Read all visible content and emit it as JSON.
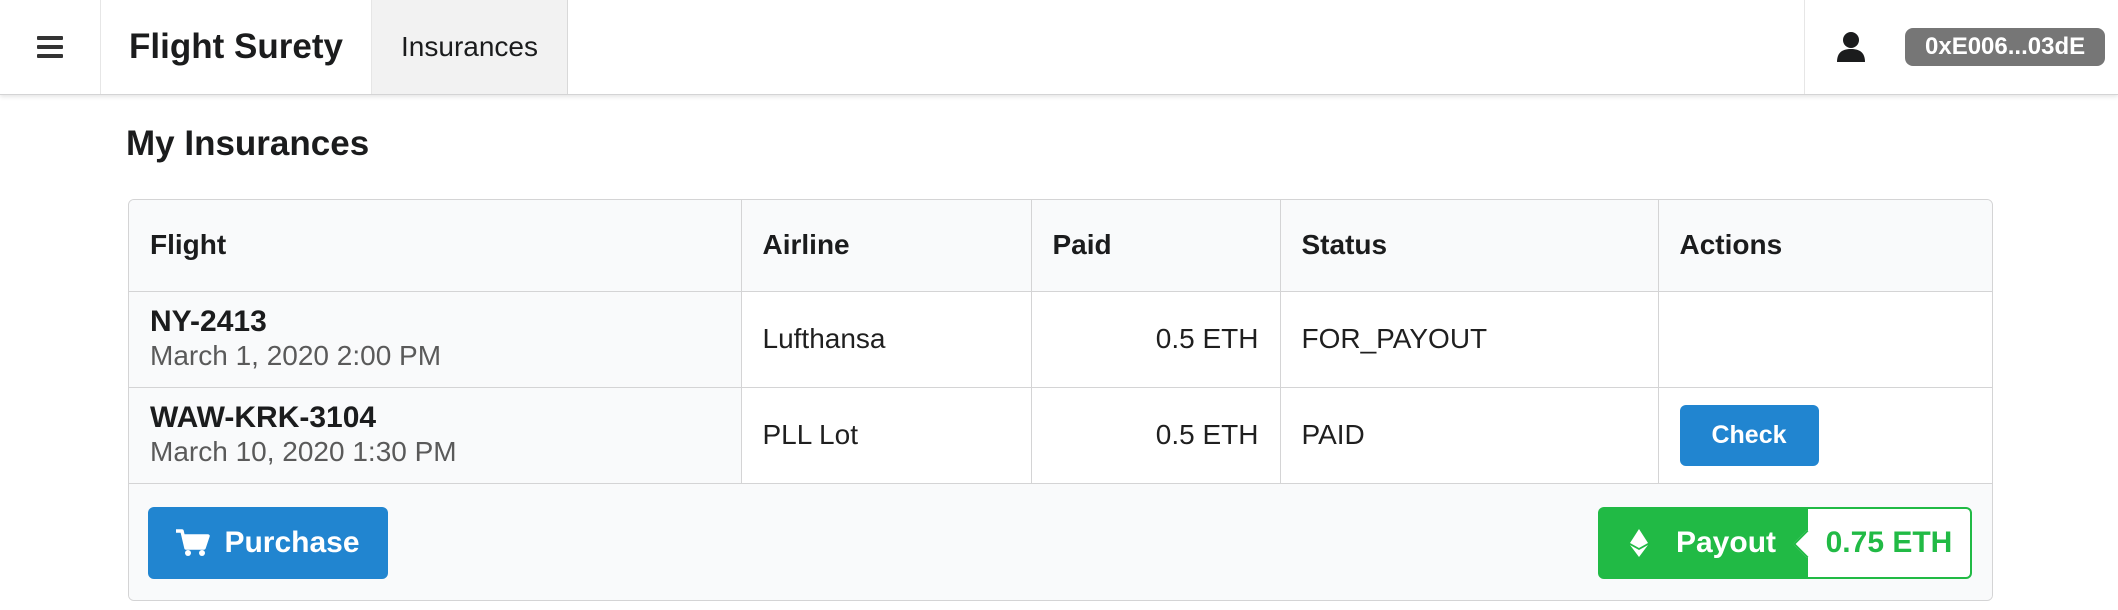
{
  "topbar": {
    "menu_icon": "hamburger-menu-icon",
    "brand": "Flight Surety",
    "active_tab": "Insurances",
    "user_icon": "user-icon",
    "account": "0xE006...03dE"
  },
  "page": {
    "title": "My Insurances"
  },
  "table": {
    "headers": [
      "Flight",
      "Airline",
      "Paid",
      "Status",
      "Actions"
    ],
    "rows": [
      {
        "flight": "NY-2413",
        "date": "March 1, 2020 2:00 PM",
        "airline": "Lufthansa",
        "paid": "0.5 ETH",
        "status": "FOR_PAYOUT",
        "action": ""
      },
      {
        "flight": "WAW-KRK-3104",
        "date": "March 10, 2020 1:30 PM",
        "airline": "PLL Lot",
        "paid": "0.5 ETH",
        "status": "PAID",
        "action": "Check"
      }
    ]
  },
  "footer": {
    "purchase_label": "Purchase",
    "purchase_icon": "shopping-cart-icon",
    "payout_label": "Payout",
    "payout_icon": "ethereum-icon",
    "payout_amount": "0.75 ETH"
  },
  "colors": {
    "primary": "#2185d0",
    "success": "#21ba45",
    "account_badge": "#767676"
  }
}
